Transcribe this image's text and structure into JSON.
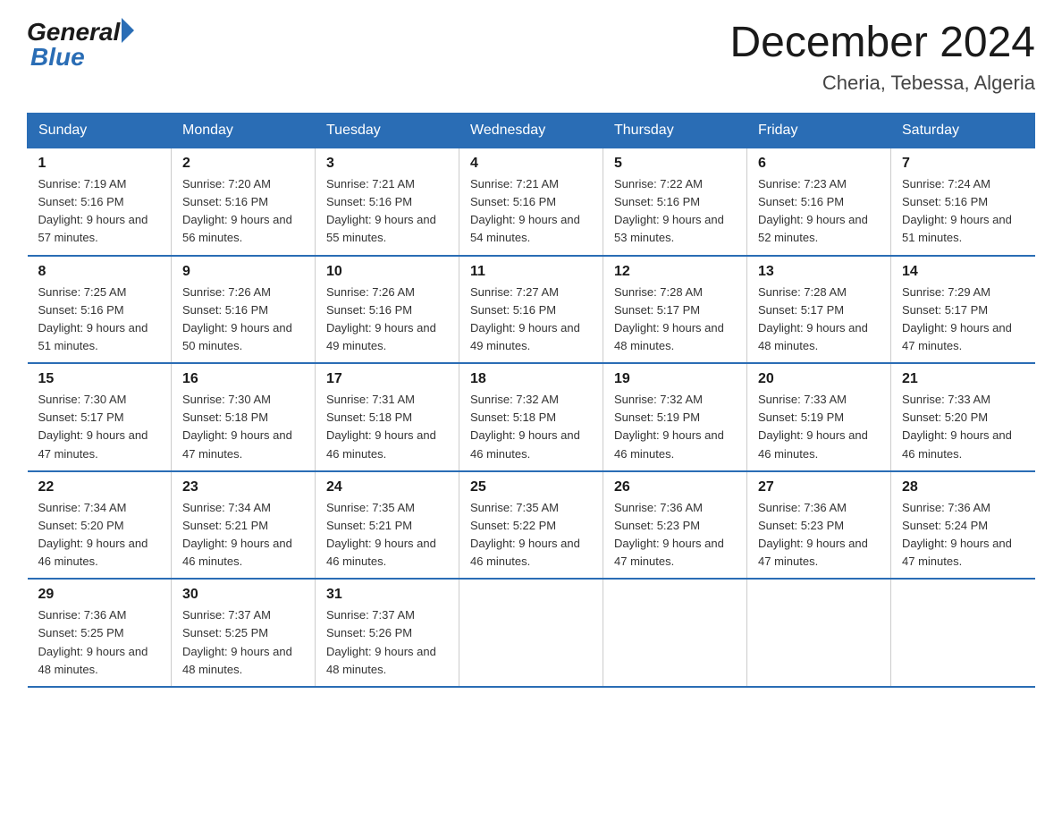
{
  "header": {
    "logo_general": "General",
    "logo_blue": "Blue",
    "month_title": "December 2024",
    "location": "Cheria, Tebessa, Algeria"
  },
  "columns": [
    "Sunday",
    "Monday",
    "Tuesday",
    "Wednesday",
    "Thursday",
    "Friday",
    "Saturday"
  ],
  "weeks": [
    [
      {
        "day": "1",
        "sunrise": "7:19 AM",
        "sunset": "5:16 PM",
        "daylight": "9 hours and 57 minutes."
      },
      {
        "day": "2",
        "sunrise": "7:20 AM",
        "sunset": "5:16 PM",
        "daylight": "9 hours and 56 minutes."
      },
      {
        "day": "3",
        "sunrise": "7:21 AM",
        "sunset": "5:16 PM",
        "daylight": "9 hours and 55 minutes."
      },
      {
        "day": "4",
        "sunrise": "7:21 AM",
        "sunset": "5:16 PM",
        "daylight": "9 hours and 54 minutes."
      },
      {
        "day": "5",
        "sunrise": "7:22 AM",
        "sunset": "5:16 PM",
        "daylight": "9 hours and 53 minutes."
      },
      {
        "day": "6",
        "sunrise": "7:23 AM",
        "sunset": "5:16 PM",
        "daylight": "9 hours and 52 minutes."
      },
      {
        "day": "7",
        "sunrise": "7:24 AM",
        "sunset": "5:16 PM",
        "daylight": "9 hours and 51 minutes."
      }
    ],
    [
      {
        "day": "8",
        "sunrise": "7:25 AM",
        "sunset": "5:16 PM",
        "daylight": "9 hours and 51 minutes."
      },
      {
        "day": "9",
        "sunrise": "7:26 AM",
        "sunset": "5:16 PM",
        "daylight": "9 hours and 50 minutes."
      },
      {
        "day": "10",
        "sunrise": "7:26 AM",
        "sunset": "5:16 PM",
        "daylight": "9 hours and 49 minutes."
      },
      {
        "day": "11",
        "sunrise": "7:27 AM",
        "sunset": "5:16 PM",
        "daylight": "9 hours and 49 minutes."
      },
      {
        "day": "12",
        "sunrise": "7:28 AM",
        "sunset": "5:17 PM",
        "daylight": "9 hours and 48 minutes."
      },
      {
        "day": "13",
        "sunrise": "7:28 AM",
        "sunset": "5:17 PM",
        "daylight": "9 hours and 48 minutes."
      },
      {
        "day": "14",
        "sunrise": "7:29 AM",
        "sunset": "5:17 PM",
        "daylight": "9 hours and 47 minutes."
      }
    ],
    [
      {
        "day": "15",
        "sunrise": "7:30 AM",
        "sunset": "5:17 PM",
        "daylight": "9 hours and 47 minutes."
      },
      {
        "day": "16",
        "sunrise": "7:30 AM",
        "sunset": "5:18 PM",
        "daylight": "9 hours and 47 minutes."
      },
      {
        "day": "17",
        "sunrise": "7:31 AM",
        "sunset": "5:18 PM",
        "daylight": "9 hours and 46 minutes."
      },
      {
        "day": "18",
        "sunrise": "7:32 AM",
        "sunset": "5:18 PM",
        "daylight": "9 hours and 46 minutes."
      },
      {
        "day": "19",
        "sunrise": "7:32 AM",
        "sunset": "5:19 PM",
        "daylight": "9 hours and 46 minutes."
      },
      {
        "day": "20",
        "sunrise": "7:33 AM",
        "sunset": "5:19 PM",
        "daylight": "9 hours and 46 minutes."
      },
      {
        "day": "21",
        "sunrise": "7:33 AM",
        "sunset": "5:20 PM",
        "daylight": "9 hours and 46 minutes."
      }
    ],
    [
      {
        "day": "22",
        "sunrise": "7:34 AM",
        "sunset": "5:20 PM",
        "daylight": "9 hours and 46 minutes."
      },
      {
        "day": "23",
        "sunrise": "7:34 AM",
        "sunset": "5:21 PM",
        "daylight": "9 hours and 46 minutes."
      },
      {
        "day": "24",
        "sunrise": "7:35 AM",
        "sunset": "5:21 PM",
        "daylight": "9 hours and 46 minutes."
      },
      {
        "day": "25",
        "sunrise": "7:35 AM",
        "sunset": "5:22 PM",
        "daylight": "9 hours and 46 minutes."
      },
      {
        "day": "26",
        "sunrise": "7:36 AM",
        "sunset": "5:23 PM",
        "daylight": "9 hours and 47 minutes."
      },
      {
        "day": "27",
        "sunrise": "7:36 AM",
        "sunset": "5:23 PM",
        "daylight": "9 hours and 47 minutes."
      },
      {
        "day": "28",
        "sunrise": "7:36 AM",
        "sunset": "5:24 PM",
        "daylight": "9 hours and 47 minutes."
      }
    ],
    [
      {
        "day": "29",
        "sunrise": "7:36 AM",
        "sunset": "5:25 PM",
        "daylight": "9 hours and 48 minutes."
      },
      {
        "day": "30",
        "sunrise": "7:37 AM",
        "sunset": "5:25 PM",
        "daylight": "9 hours and 48 minutes."
      },
      {
        "day": "31",
        "sunrise": "7:37 AM",
        "sunset": "5:26 PM",
        "daylight": "9 hours and 48 minutes."
      },
      null,
      null,
      null,
      null
    ]
  ]
}
